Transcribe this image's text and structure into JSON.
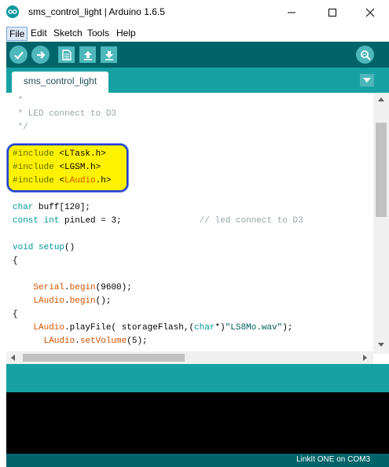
{
  "window": {
    "title": "sms_control_light | Arduino 1.6.5"
  },
  "menu": [
    "File",
    "Edit",
    "Sketch",
    "Tools",
    "Help"
  ],
  "toolbar": {
    "buttons": [
      "check-icon",
      "arrow-right-icon",
      "new-file-icon",
      "open-arrow-up-icon",
      "save-arrow-down-icon",
      "serial-monitor-icon"
    ]
  },
  "tabs": {
    "active": "sms_control_light"
  },
  "editor": {
    "lines": [
      [
        {
          "c": "cm",
          "t": " *"
        }
      ],
      [
        {
          "c": "cm",
          "t": " * LED connect to D3"
        }
      ],
      [
        {
          "c": "cm",
          "t": " */"
        }
      ],
      [
        {
          "c": "",
          "t": ""
        }
      ],
      [
        {
          "c": "pp",
          "t": "#include "
        },
        {
          "c": "",
          "t": "<LTask.h>"
        }
      ],
      [
        {
          "c": "pp",
          "t": "#include "
        },
        {
          "c": "",
          "t": "<LGSM.h>"
        }
      ],
      [
        {
          "c": "pp",
          "t": "#include "
        },
        {
          "c": "",
          "t": "<"
        },
        {
          "c": "fn",
          "t": "LAudio"
        },
        {
          "c": "",
          "t": ".h>"
        }
      ],
      [
        {
          "c": "",
          "t": ""
        }
      ],
      [
        {
          "c": "kw",
          "t": "char"
        },
        {
          "c": "",
          "t": " buff[120];"
        }
      ],
      [
        {
          "c": "kw",
          "t": "const"
        },
        {
          "c": "",
          "t": " "
        },
        {
          "c": "kw",
          "t": "int"
        },
        {
          "c": "",
          "t": " pinLed = 3;               "
        },
        {
          "c": "cm",
          "t": "// led connect to D3"
        }
      ],
      [
        {
          "c": "",
          "t": ""
        }
      ],
      [
        {
          "c": "kw",
          "t": "void"
        },
        {
          "c": "",
          "t": " "
        },
        {
          "c": "kw",
          "t": "setup"
        },
        {
          "c": "",
          "t": "()"
        }
      ],
      [
        {
          "c": "",
          "t": "{"
        }
      ],
      [
        {
          "c": "",
          "t": ""
        }
      ],
      [
        {
          "c": "",
          "t": "    "
        },
        {
          "c": "fn",
          "t": "Serial"
        },
        {
          "c": "",
          "t": "."
        },
        {
          "c": "fn",
          "t": "begin"
        },
        {
          "c": "",
          "t": "(9600);"
        }
      ],
      [
        {
          "c": "",
          "t": "    "
        },
        {
          "c": "fn",
          "t": "LAudio"
        },
        {
          "c": "",
          "t": "."
        },
        {
          "c": "fn",
          "t": "begin"
        },
        {
          "c": "",
          "t": "();"
        }
      ],
      [
        {
          "c": "",
          "t": "{"
        }
      ],
      [
        {
          "c": "",
          "t": "    "
        },
        {
          "c": "fn",
          "t": "LAudio"
        },
        {
          "c": "",
          "t": ".playFile( storageFlash,("
        },
        {
          "c": "kw",
          "t": "char"
        },
        {
          "c": "",
          "t": "*)"
        },
        {
          "c": "st",
          "t": "\"LS8Mo.wav\""
        },
        {
          "c": "",
          "t": ");"
        }
      ],
      [
        {
          "c": "",
          "t": "      "
        },
        {
          "c": "fn",
          "t": "LAudio"
        },
        {
          "c": "",
          "t": "."
        },
        {
          "c": "fn",
          "t": "setVolume"
        },
        {
          "c": "",
          "t": "(5);"
        }
      ]
    ]
  },
  "status": {
    "board": "LinkIt ONE on COM3"
  },
  "colors": {
    "teal_dark": "#006468",
    "teal": "#17a1a5",
    "button": "#4db7bb",
    "highlight": "#fff200"
  }
}
